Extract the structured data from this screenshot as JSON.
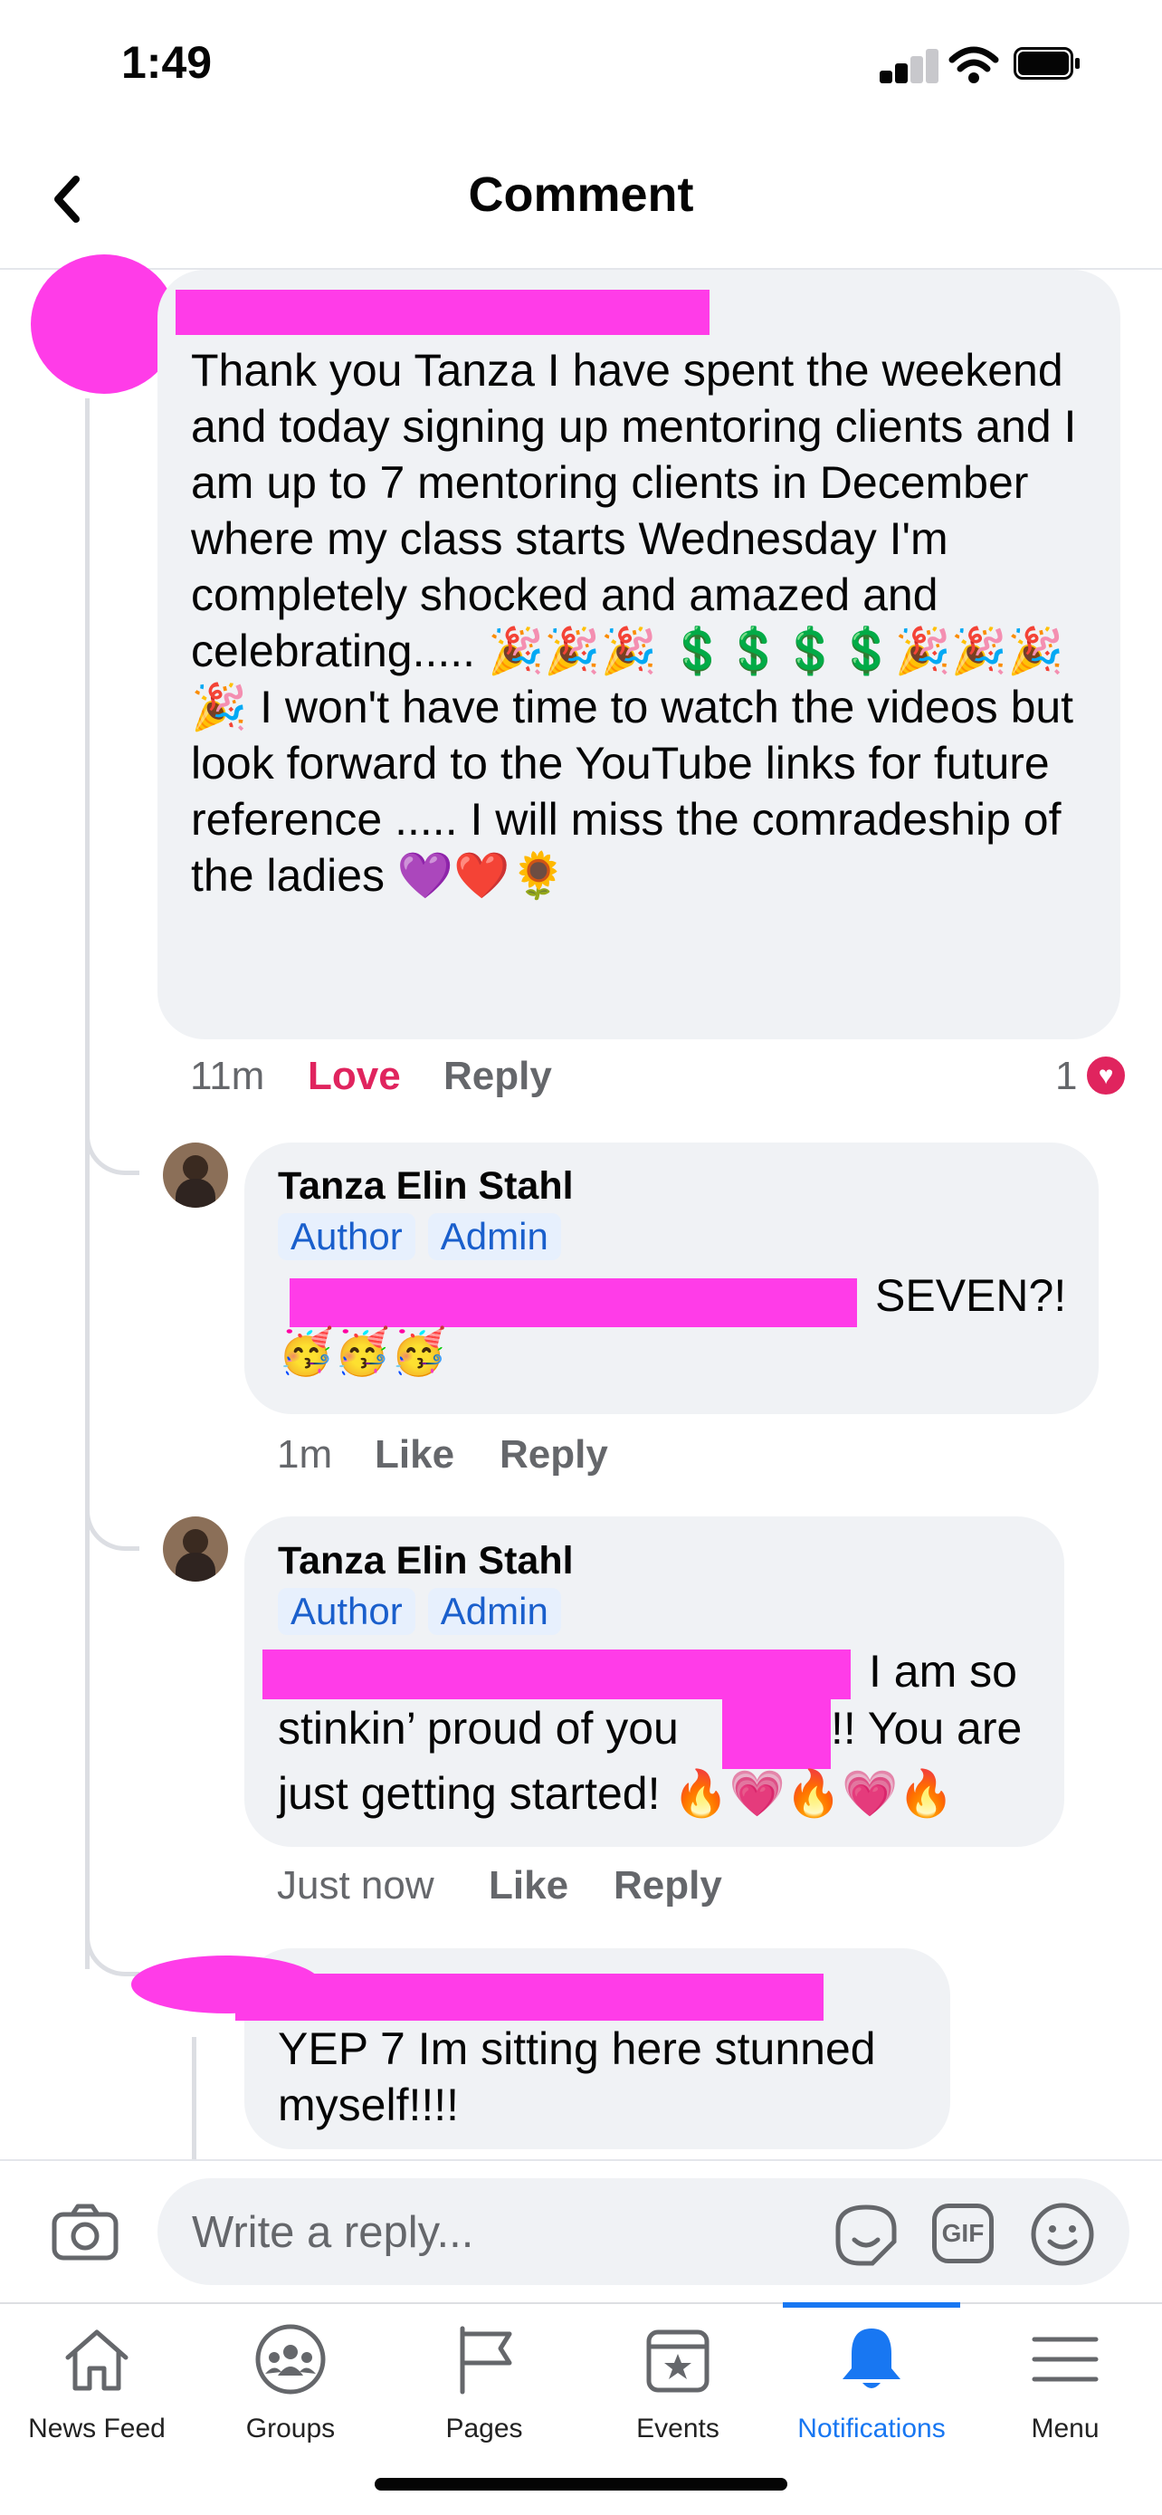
{
  "status_bar": {
    "time": "1:49"
  },
  "header": {
    "title": "Comment"
  },
  "comments": [
    {
      "text": "Thank you Tanza I have spent the weekend and today signing up mentoring clients and I am up to 7 mentoring clients in December where my class starts Wednesday I'm completely shocked and amazed and celebrating..... 🎉🎉🎉 💲💲💲💲🎉🎉🎉🎉 I won't have time to watch the videos but look forward to the YouTube links for future reference ..... I will miss the comradeship of the ladies 💜❤️🌻",
      "time": "11m",
      "reaction_label": "Love",
      "reply_label": "Reply",
      "reaction_count": "1"
    },
    {
      "author": "Tanza Elin Stahl",
      "badges": [
        "Author",
        "Admin"
      ],
      "text": "SEVEN?! 🥳🥳🥳",
      "time": "1m",
      "like_label": "Like",
      "reply_label": "Reply"
    },
    {
      "author": "Tanza Elin Stahl",
      "badges": [
        "Author",
        "Admin"
      ],
      "text_1": "I am so",
      "text_2": "stinkin’ proud of you",
      "text_3": "!! You are",
      "text_4": "just getting started! 🔥💗🔥💗🔥",
      "time": "Just now",
      "like_label": "Like",
      "reply_label": "Reply"
    },
    {
      "text": "YEP 7 Im sitting here stunned myself!!!!"
    }
  ],
  "reply_bar": {
    "placeholder": "Write a reply..."
  },
  "tabs": [
    {
      "label": "News Feed",
      "icon": "home-icon"
    },
    {
      "label": "Groups",
      "icon": "groups-icon"
    },
    {
      "label": "Pages",
      "icon": "flag-icon"
    },
    {
      "label": "Events",
      "icon": "calendar-star-icon"
    },
    {
      "label": "Notifications",
      "icon": "bell-icon",
      "active": true
    },
    {
      "label": "Menu",
      "icon": "menu-icon"
    }
  ],
  "colors": {
    "accent": "#1877f2",
    "love": "#e0245e",
    "redaction": "#ff3ce8",
    "bubble": "#f0f2f5"
  }
}
